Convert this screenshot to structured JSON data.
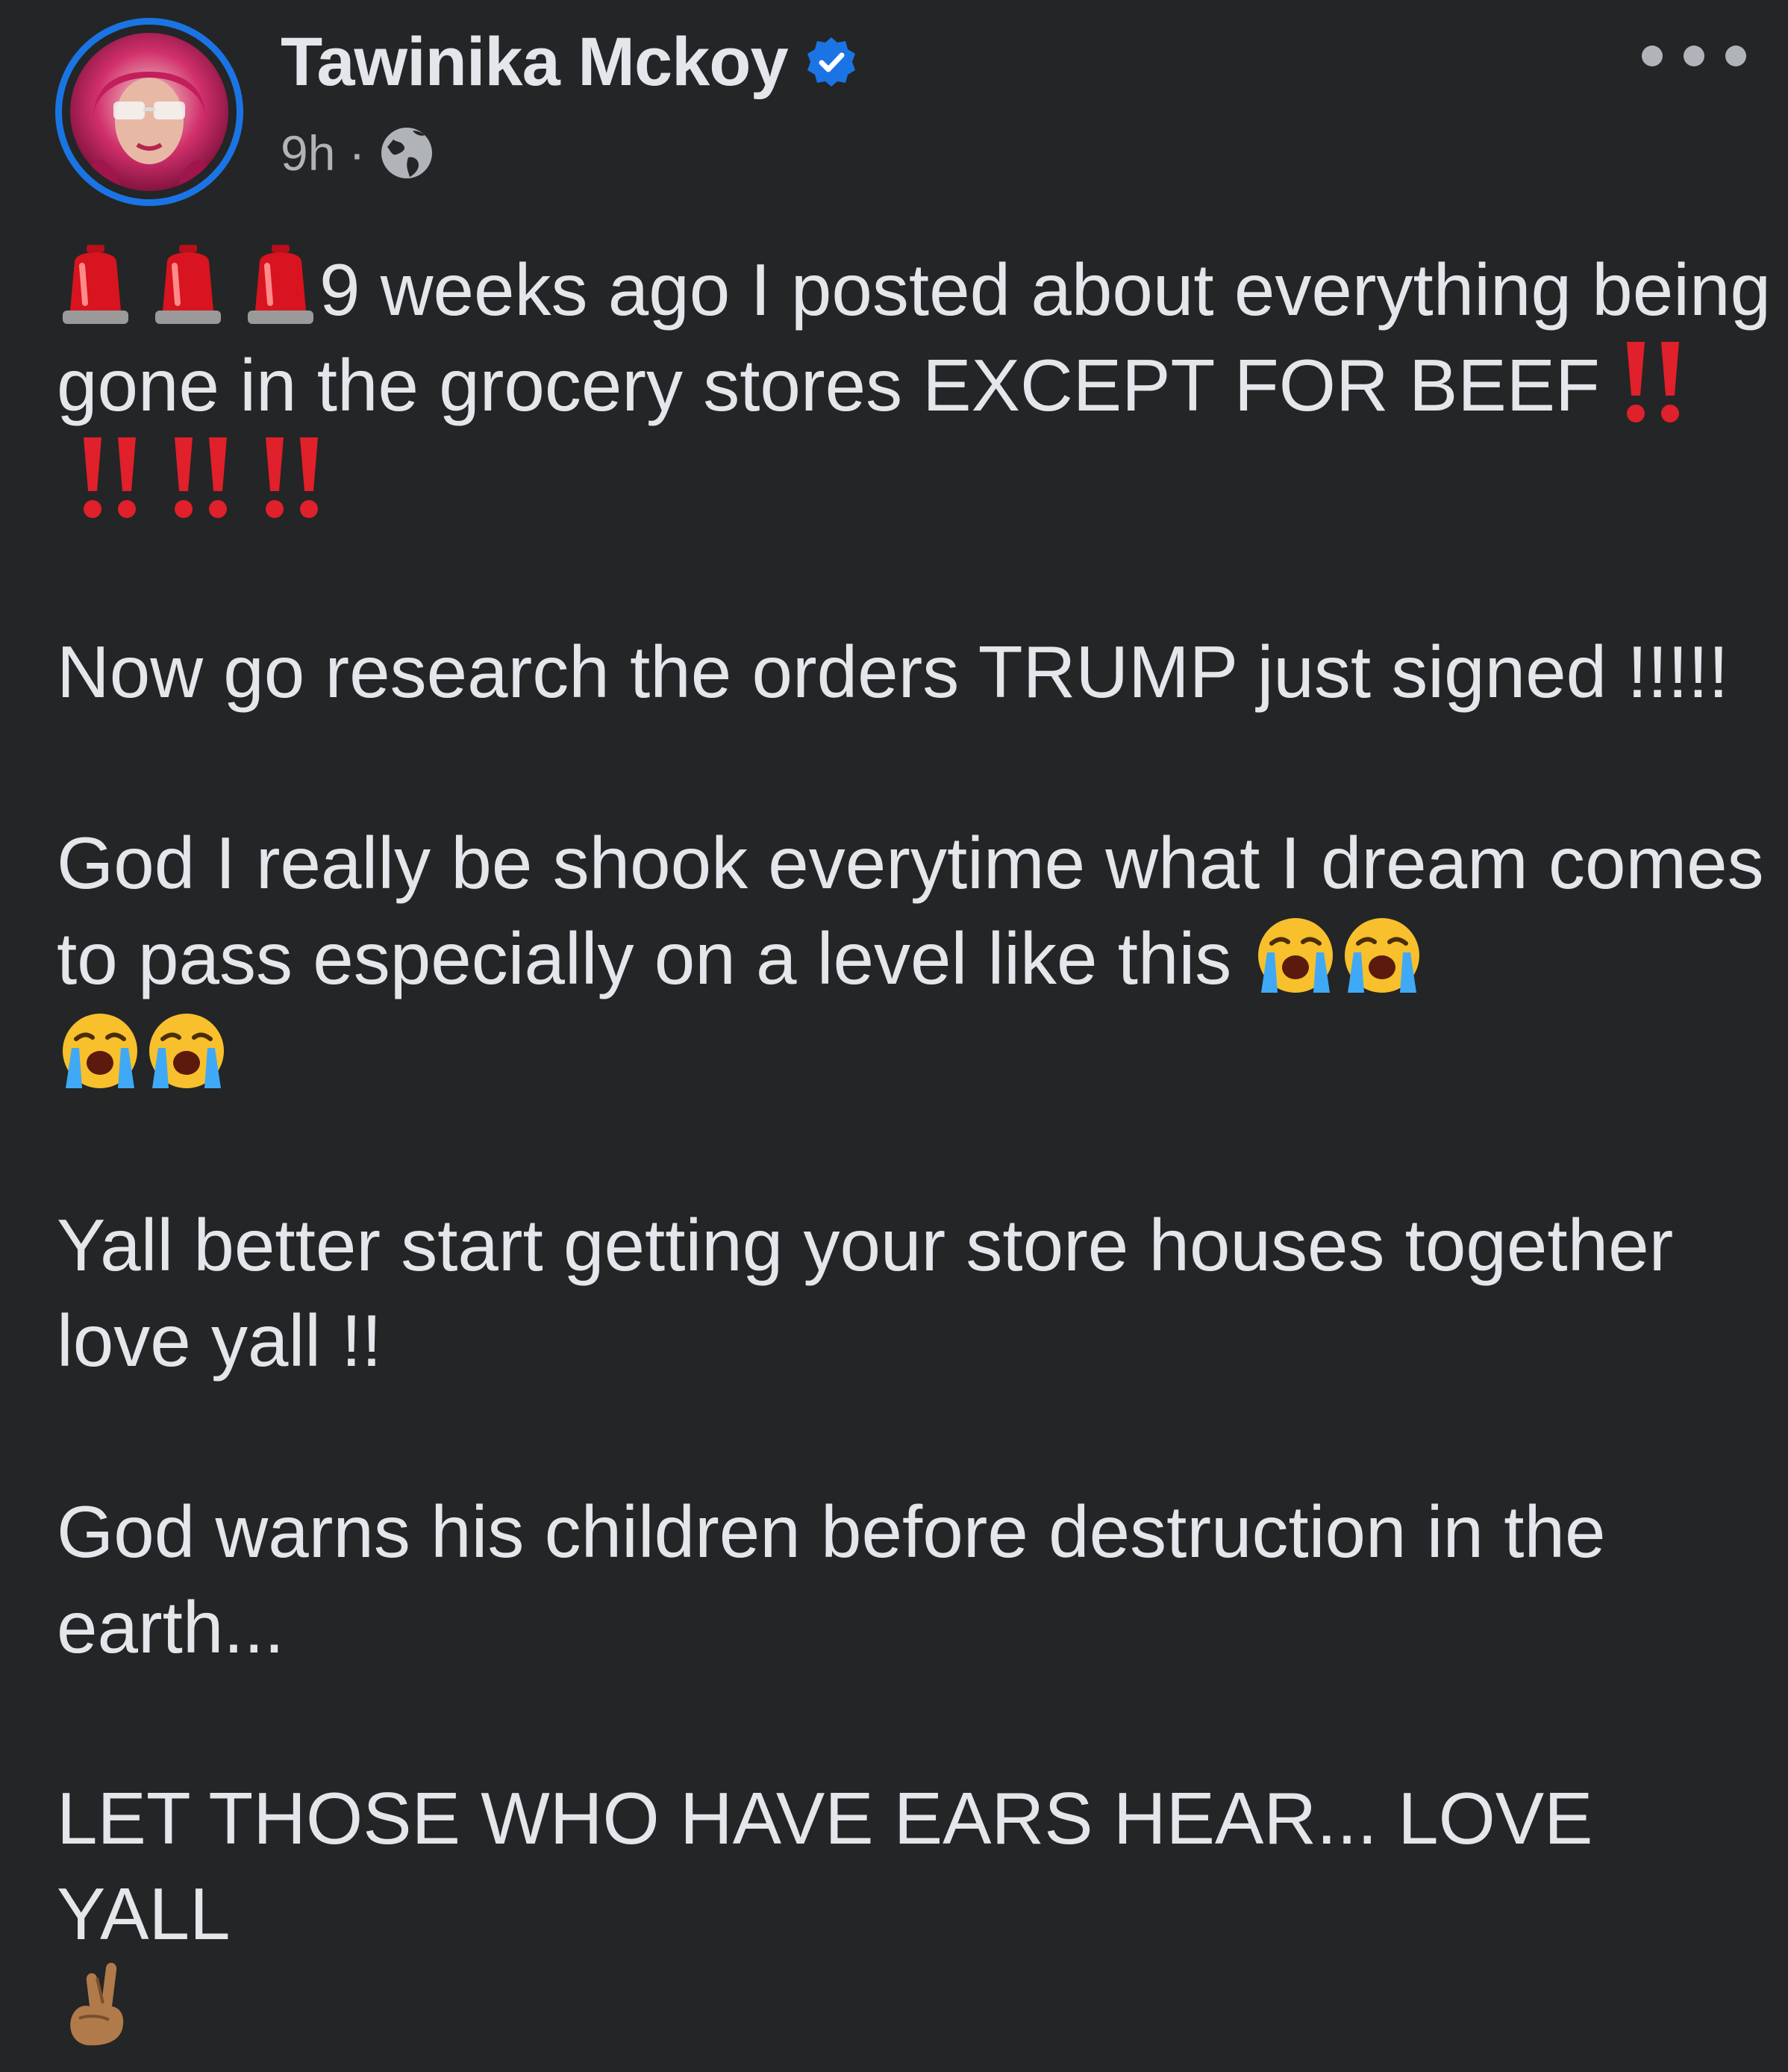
{
  "post": {
    "author": {
      "name": "Tawinika Mckoy",
      "verified": true
    },
    "meta": {
      "time": "9h",
      "separator": "·",
      "audience_icon": "globe-icon"
    },
    "more_icon": "more-options-icon",
    "paragraphs": {
      "p1": {
        "emojis_lead": [
          "police-light-emoji",
          "police-light-emoji",
          "police-light-emoji"
        ],
        "text": "9 weeks ago I posted about everything being gone in the grocery stores EXCEPT FOR BEEF",
        "emojis_trail": [
          "double-exclamation-emoji",
          "double-exclamation-emoji",
          "double-exclamation-emoji",
          "double-exclamation-emoji"
        ]
      },
      "p2": {
        "text": "Now go research the orders TRUMP just signed !!!!!"
      },
      "p3": {
        "text": "God I really be shook everytime what I dream comes to pass especially on a level like this",
        "emojis_trail": [
          "crying-face-emoji",
          "crying-face-emoji",
          "crying-face-emoji",
          "crying-face-emoji"
        ]
      },
      "p4": {
        "text": "Yall better start getting your store houses together love yall !!"
      },
      "p5": {
        "text": "God warns his children before destruction in the earth..."
      },
      "p6": {
        "text": "LET THOSE WHO HAVE EARS HEAR... LOVE YALL",
        "emojis_trail": [
          "crossed-fingers-emoji"
        ]
      }
    }
  },
  "colors": {
    "background": "#242526",
    "primary_text": "#e4e6eb",
    "secondary_text": "#b0b3b8",
    "accent_blue": "#1b74e4",
    "alert_red": "#e0202a"
  }
}
